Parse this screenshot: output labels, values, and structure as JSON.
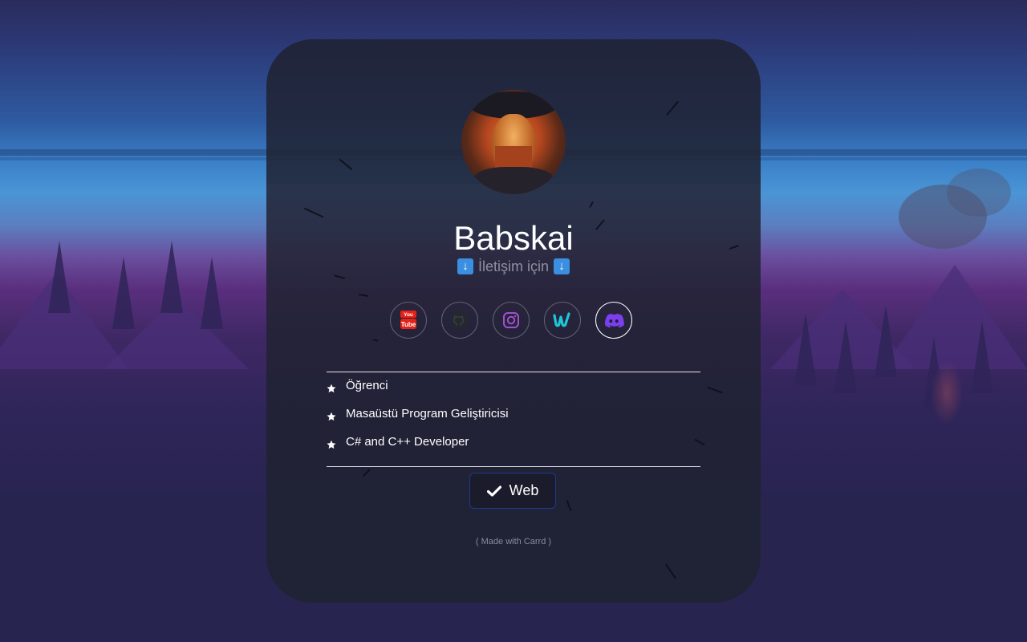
{
  "profile": {
    "name": "Babskai",
    "subtitle": "İletişim için",
    "subtitle_arrow": "↓",
    "avatar_alt": "profile picture"
  },
  "socials": [
    {
      "name": "youtube",
      "icon": "youtube-icon",
      "color": "#e62117"
    },
    {
      "name": "github",
      "icon": "github-icon",
      "color": "#24292e"
    },
    {
      "name": "instagram",
      "icon": "instagram-icon",
      "color": "#a34fd1"
    },
    {
      "name": "upwork",
      "icon": "upwork-icon",
      "color": "#1ec6d8"
    },
    {
      "name": "discord",
      "icon": "discord-icon",
      "color": "#7c3ff0"
    }
  ],
  "roles": [
    "Öğrenci",
    "Masaüstü Program Geliştiricisi",
    "C# and C++ Developer"
  ],
  "web_button": {
    "label": "Web",
    "icon": "check-icon"
  },
  "credit": "( Made with Carrd )",
  "colors": {
    "card_bg": "#1f2231",
    "button_border": "#1d3a8c",
    "subtitle_arrow_bg": "#3a8fe0"
  }
}
